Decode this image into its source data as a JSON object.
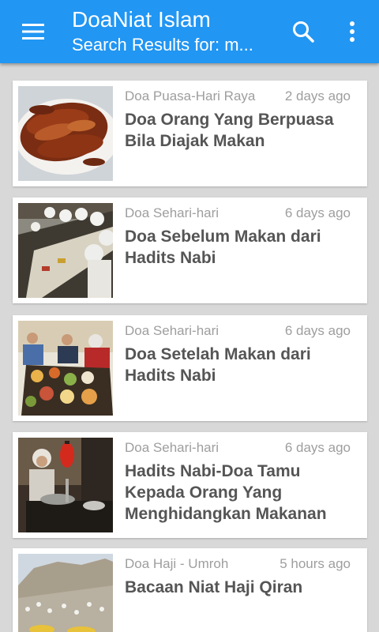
{
  "appbar": {
    "title": "DoaNiat Islam",
    "subtitle": "Search Results for: m...",
    "menu_icon": "hamburger-menu-icon",
    "search_icon": "search-icon",
    "more_icon": "more-vertical-icon",
    "color": "#2196f3"
  },
  "results": [
    {
      "category": "Doa Puasa-Hari Raya",
      "time": "2 days ago",
      "title": "Doa Orang Yang Berpuasa Bila Diajak Makan",
      "thumbnail": "grilled-fish-photo"
    },
    {
      "category": "Doa Sehari-hari",
      "time": "6 days ago",
      "title": "Doa Sebelum Makan dari Hadits Nabi",
      "thumbnail": "communal-meal-photo"
    },
    {
      "category": "Doa Sehari-hari",
      "time": "6 days ago",
      "title": "Doa Setelah Makan dari Hadits Nabi",
      "thumbnail": "family-dinner-photo"
    },
    {
      "category": "Doa Sehari-hari",
      "time": "6 days ago",
      "title": "Hadits Nabi-Doa Tamu Kepada Orang Yang Menghidangkan Makanan",
      "thumbnail": "host-serving-photo"
    },
    {
      "category": "Doa Haji - Umroh",
      "time": "5 hours ago",
      "title": "Bacaan Niat Haji Qiran",
      "thumbnail": "hajj-pilgrims-photo"
    }
  ]
}
